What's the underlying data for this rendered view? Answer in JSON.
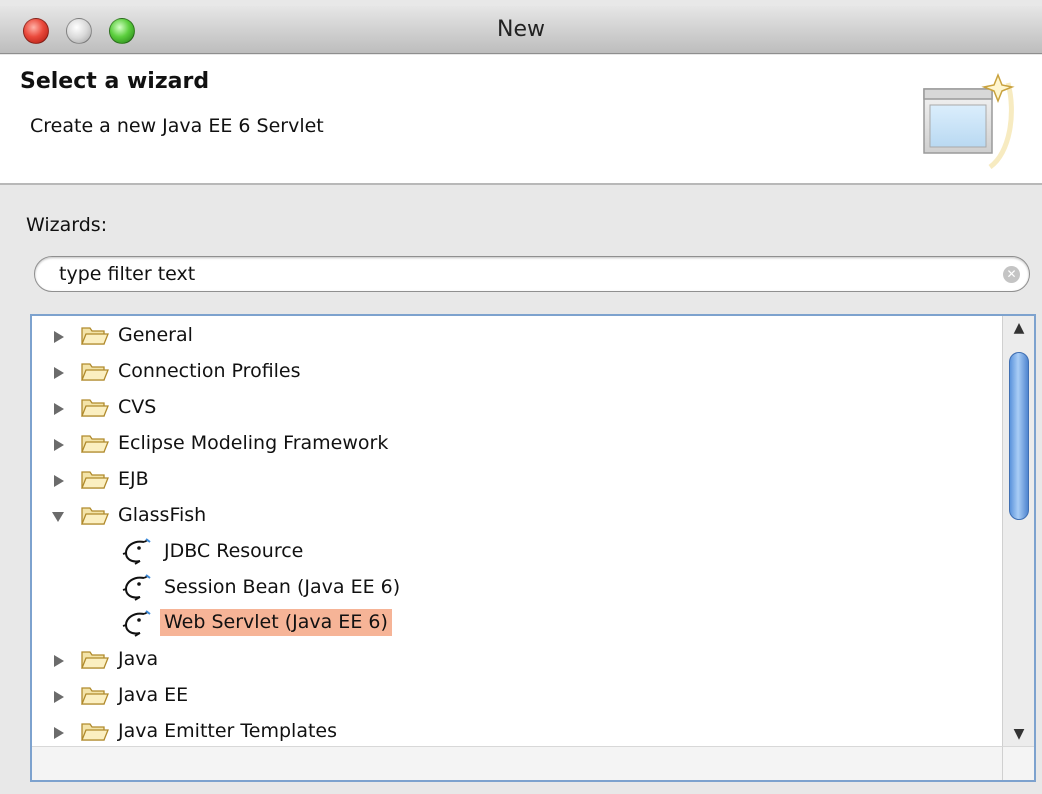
{
  "window": {
    "title": "New",
    "controls": [
      "close",
      "minimize",
      "zoom"
    ]
  },
  "header": {
    "heading": "Select a wizard",
    "description": "Create a new Java EE 6 Servlet",
    "graphic_icon": "new-wizard-graphic-icon"
  },
  "wizards_label": "Wizards:",
  "filter": {
    "value": "",
    "placeholder": "type filter text",
    "clear_icon": "clear-icon"
  },
  "tree": {
    "items": [
      {
        "label": "General",
        "type": "folder",
        "expanded": false,
        "level": 0
      },
      {
        "label": "Connection Profiles",
        "type": "folder",
        "expanded": false,
        "level": 0
      },
      {
        "label": "CVS",
        "type": "folder",
        "expanded": false,
        "level": 0
      },
      {
        "label": "Eclipse Modeling Framework",
        "type": "folder",
        "expanded": false,
        "level": 0
      },
      {
        "label": "EJB",
        "type": "folder",
        "expanded": false,
        "level": 0
      },
      {
        "label": "GlassFish",
        "type": "folder",
        "expanded": true,
        "level": 0
      },
      {
        "label": "JDBC Resource",
        "type": "wizard",
        "level": 1
      },
      {
        "label": "Session Bean (Java EE 6)",
        "type": "wizard",
        "level": 1
      },
      {
        "label": "Web Servlet (Java EE 6)",
        "type": "wizard",
        "level": 1,
        "selected": true
      },
      {
        "label": "Java",
        "type": "folder",
        "expanded": false,
        "level": 0
      },
      {
        "label": "Java EE",
        "type": "folder",
        "expanded": false,
        "level": 0
      },
      {
        "label": "Java Emitter Templates",
        "type": "folder",
        "expanded": false,
        "level": 0
      }
    ]
  },
  "colors": {
    "selection": "#f6b497",
    "tree_border": "#7da2ce",
    "scroll_thumb": "#5c94dc"
  }
}
